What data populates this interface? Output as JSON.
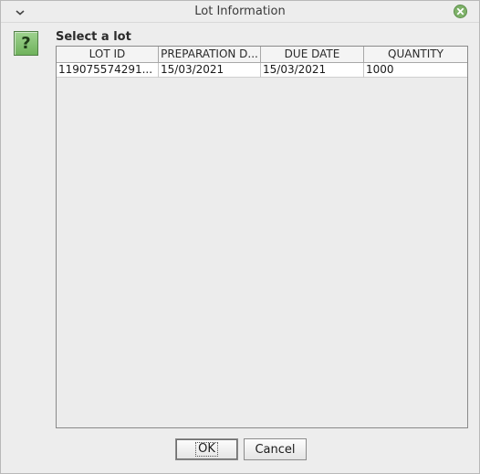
{
  "window": {
    "title": "Lot Information",
    "menu_icon": "chevron-down-icon",
    "close_icon": "close-circle-icon"
  },
  "dialog": {
    "icon": "question-icon",
    "icon_glyph": "?",
    "prompt": "Select a lot"
  },
  "table": {
    "columns": [
      "LOT ID",
      "PREPARATION D...",
      "DUE DATE",
      "QUANTITY"
    ],
    "rows": [
      [
        "119075574291...",
        "15/03/2021",
        "15/03/2021",
        "1000"
      ]
    ]
  },
  "buttons": {
    "ok_label": "OK",
    "cancel_label": "Cancel"
  },
  "colors": {
    "background": "#ededed",
    "icon_green": "#6fb25c",
    "close_green": "#7fb26a"
  }
}
